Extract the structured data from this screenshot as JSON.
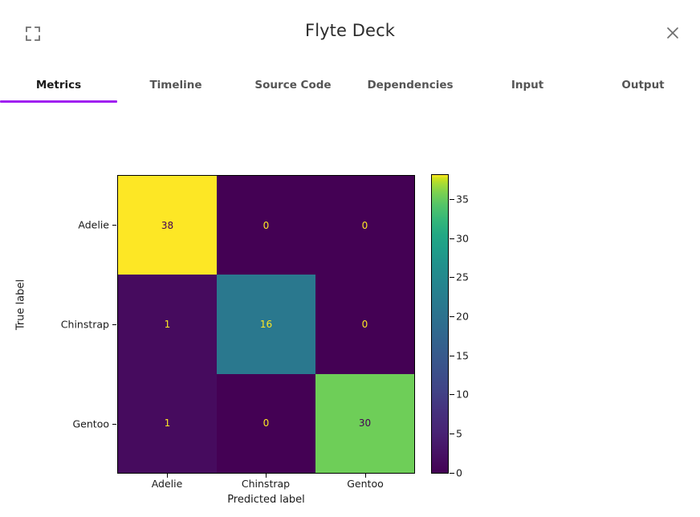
{
  "header": {
    "title": "Flyte Deck",
    "expand_icon": "fullscreen-expand-icon",
    "close_icon": "close-x-icon"
  },
  "tabs": [
    {
      "label": "Metrics",
      "active": true
    },
    {
      "label": "Timeline",
      "active": false
    },
    {
      "label": "Source Code",
      "active": false
    },
    {
      "label": "Dependencies",
      "active": false
    },
    {
      "label": "Input",
      "active": false
    },
    {
      "label": "Output",
      "active": false
    }
  ],
  "colors": {
    "accent": "#a020f0",
    "tab_inactive": "#555555",
    "tab_active": "#1a1a1a",
    "title": "#2c2c2c",
    "icon_gray": "#6e6e6e",
    "viridis_min": "#440154",
    "viridis_one": "#460b5e",
    "viridis_teal": "#2a788e",
    "viridis_green": "#6ece58",
    "viridis_max": "#fde725",
    "text_on_dark": "#fde725",
    "text_on_light": "#440154"
  },
  "chart_data": {
    "type": "heatmap",
    "title": "",
    "xlabel": "Predicted label",
    "ylabel": "True label",
    "categories_x": [
      "Adelie",
      "Chinstrap",
      "Gentoo"
    ],
    "categories_y": [
      "Adelie",
      "Chinstrap",
      "Gentoo"
    ],
    "matrix": [
      [
        38,
        0,
        0
      ],
      [
        1,
        16,
        0
      ],
      [
        1,
        0,
        30
      ]
    ],
    "cells": [
      {
        "row": 0,
        "col": 0,
        "value": "38",
        "fill": "#fde725",
        "text_color": "#440154"
      },
      {
        "row": 0,
        "col": 1,
        "value": "0",
        "fill": "#440154",
        "text_color": "#fde725"
      },
      {
        "row": 0,
        "col": 2,
        "value": "0",
        "fill": "#440154",
        "text_color": "#fde725"
      },
      {
        "row": 1,
        "col": 0,
        "value": "1",
        "fill": "#460b5e",
        "text_color": "#fde725"
      },
      {
        "row": 1,
        "col": 1,
        "value": "16",
        "fill": "#2a788e",
        "text_color": "#fde725"
      },
      {
        "row": 1,
        "col": 2,
        "value": "0",
        "fill": "#440154",
        "text_color": "#fde725"
      },
      {
        "row": 2,
        "col": 0,
        "value": "1",
        "fill": "#460b5e",
        "text_color": "#fde725"
      },
      {
        "row": 2,
        "col": 1,
        "value": "0",
        "fill": "#440154",
        "text_color": "#fde725"
      },
      {
        "row": 2,
        "col": 2,
        "value": "30",
        "fill": "#6ece58",
        "text_color": "#440154"
      }
    ],
    "colormap": "viridis",
    "colorbar": {
      "ticks": [
        "0",
        "5",
        "10",
        "15",
        "20",
        "25",
        "30",
        "35"
      ],
      "vmin": 0,
      "vmax": 38,
      "position": "right",
      "orientation": "vertical"
    },
    "grid": false,
    "legend": "colorbar"
  }
}
